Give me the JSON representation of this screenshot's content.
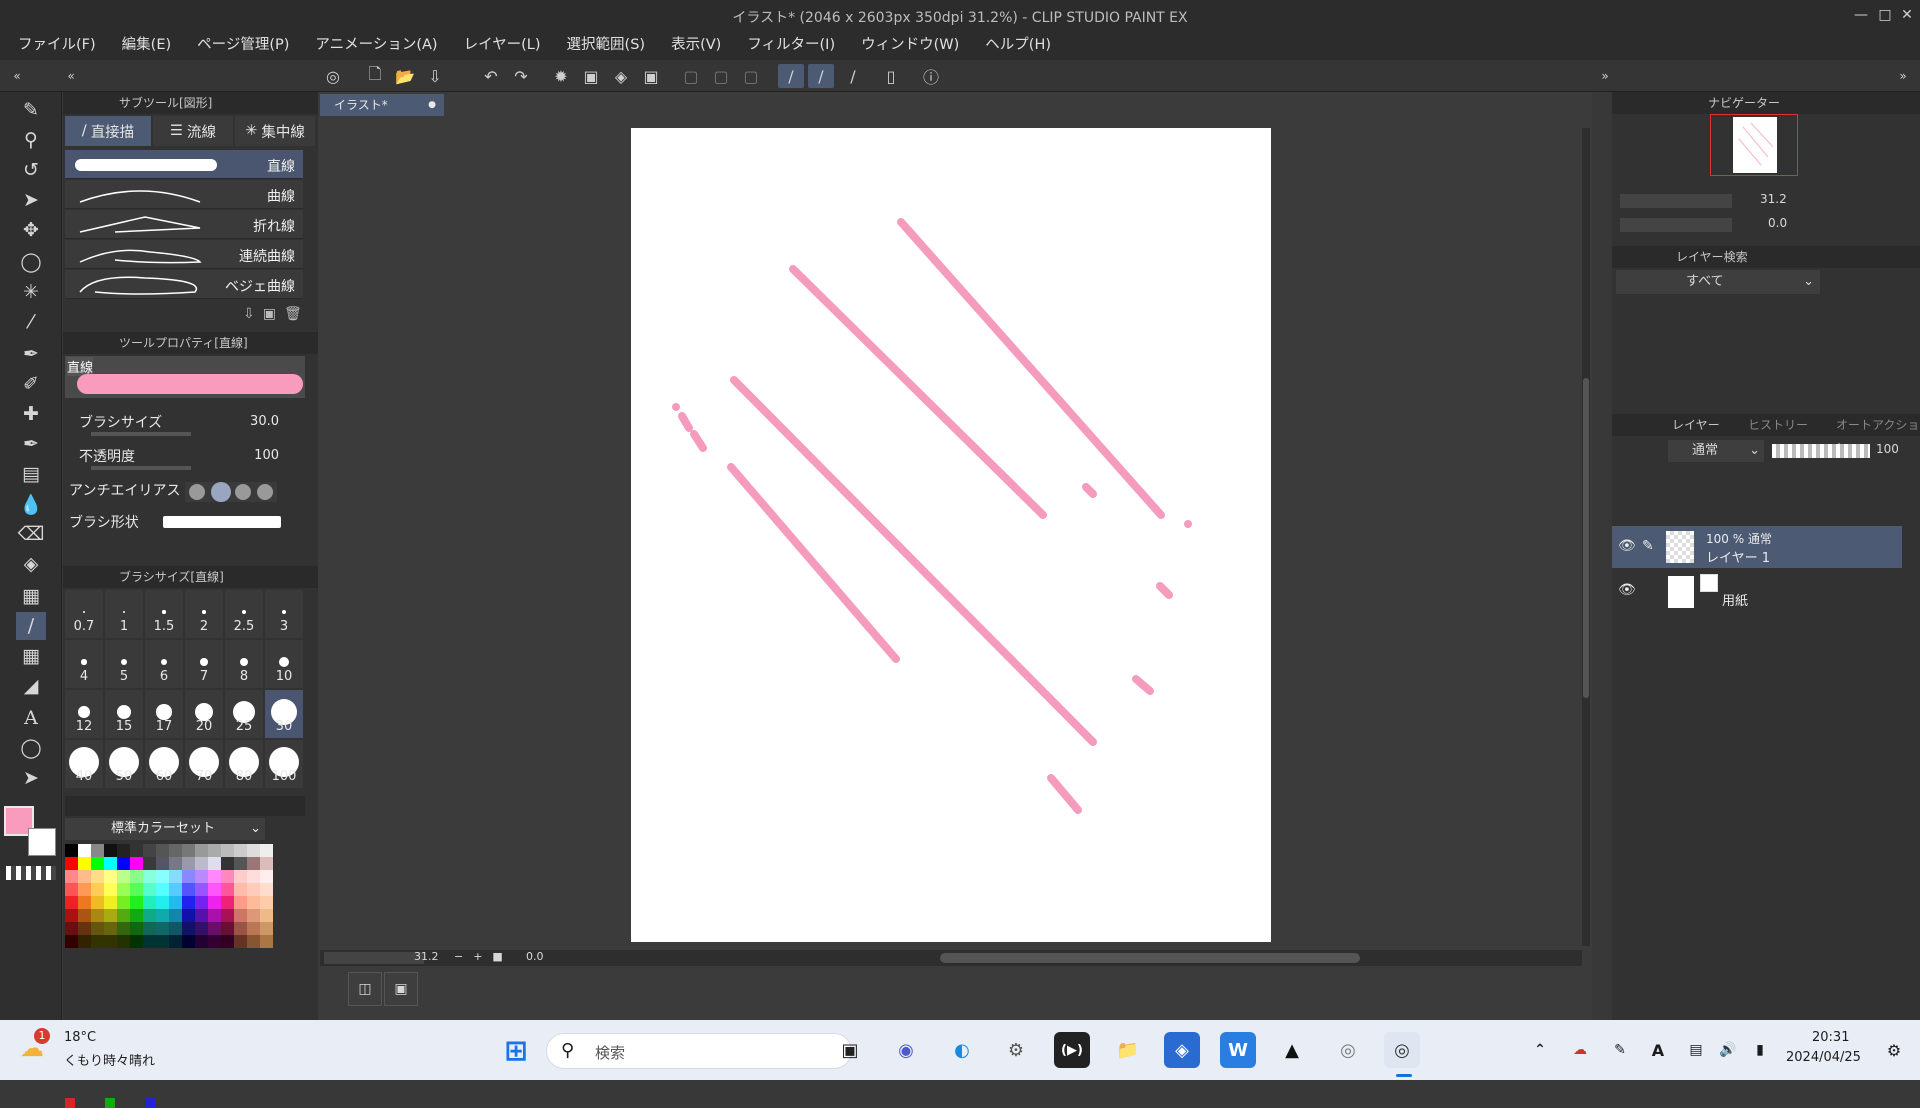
{
  "window": {
    "title": "イラスト* (2046 x 2603px 350dpi 31.2%)  - CLIP STUDIO PAINT EX"
  },
  "menu": [
    "ファイル(F)",
    "編集(E)",
    "ページ管理(P)",
    "アニメーション(A)",
    "レイヤー(L)",
    "選択範囲(S)",
    "表示(V)",
    "フィルター(I)",
    "ウィンドウ(W)",
    "ヘルプ(H)"
  ],
  "subtool": {
    "header": "サブツール[図形]",
    "tabs": [
      "直接描",
      "流線",
      "集中線"
    ],
    "items": [
      "直線",
      "曲線",
      "折れ線",
      "連続曲線",
      "ベジェ曲線"
    ]
  },
  "toolprop": {
    "header": "ツールプロパティ[直線]",
    "preview_label": "直線",
    "brush_size_label": "ブラシサイズ",
    "brush_size_value": "30.0",
    "opacity_label": "不透明度",
    "opacity_value": "100",
    "antialias_label": "アンチエイリアス",
    "brush_shape_label": "ブラシ形状"
  },
  "brushsize": {
    "header": "ブラシサイズ[直線]",
    "sizes": [
      "0.7",
      "1",
      "1.5",
      "2",
      "2.5",
      "3",
      "4",
      "5",
      "6",
      "7",
      "8",
      "10",
      "12",
      "15",
      "17",
      "20",
      "25",
      "30",
      "40",
      "50",
      "60",
      "70",
      "80",
      "100"
    ],
    "selected": "30"
  },
  "colorset": {
    "name": "標準カラーセット"
  },
  "colors": {
    "main": "#f89bbd",
    "sub": "#ffffff",
    "stroke": "#f59bbd",
    "accent": "#4d5a73"
  },
  "canvas": {
    "tab": "イラスト*",
    "zoom": "31.2",
    "rotation": "0.0"
  },
  "navigator": {
    "header": "ナビゲーター",
    "zoom": "31.2",
    "rotation": "0.0"
  },
  "layer_search": {
    "header": "レイヤー検索",
    "filter": "すべて"
  },
  "layers": {
    "tabs": [
      "レイヤー",
      "ヒストリー",
      "オートアクション"
    ],
    "blend_mode": "通常",
    "opacity": "100",
    "items": [
      {
        "info": "100 % 通常",
        "name": "レイヤー 1"
      },
      {
        "info": "",
        "name": "用紙"
      }
    ]
  },
  "taskbar": {
    "weather_temp": "18°C",
    "weather_desc": "くもり時々晴れ",
    "weather_badge": "1",
    "search_placeholder": "検索",
    "time": "20:31",
    "date": "2024/04/25"
  }
}
